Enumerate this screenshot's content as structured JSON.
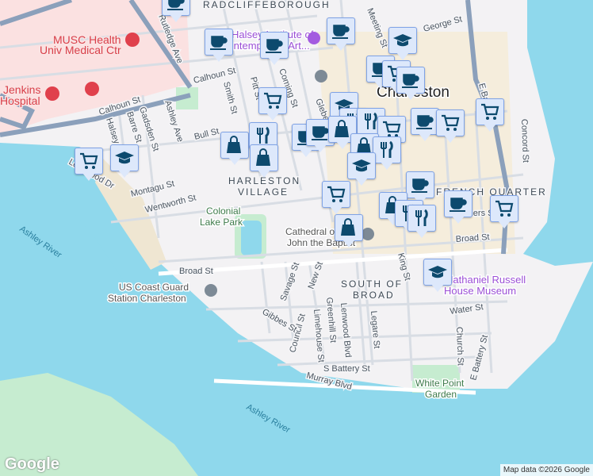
{
  "map": {
    "neighborhoods": [
      "RADCLIFFEBOROUGH",
      "HARLESTON",
      "VILLAGE",
      "FRENCH QUARTER",
      "SOUTH OF",
      "BROAD"
    ],
    "city": "Charleston",
    "streets": [
      "Rutledge Ave",
      "Calhoun St",
      "Calhoun St",
      "Smith St",
      "Pitt St",
      "Coming St",
      "Ashley Ave",
      "Halsey St",
      "Barre St",
      "Gadsden St",
      "Bull St",
      "Montagu St",
      "Lockwood Dr",
      "Wentworth St",
      "Broad St",
      "Broad St",
      "Meeting St",
      "George St",
      "Glebe St",
      "E Bay St",
      "Concord St",
      "Savage St",
      "New St",
      "King St",
      "Legare St",
      "Lenwood Blvd",
      "Greenhill St",
      "Limehouse St",
      "Council St",
      "Gibbes St",
      "Water St",
      "Church St",
      "E Battery St",
      "S Battery St",
      "Murray Blvd",
      "Chalmers St"
    ],
    "pois": {
      "musc": "MUSC Health\nUniv Medical Ctr",
      "musc_line1": "MUSC Health",
      "musc_line2": "Univ Medical Ctr",
      "jenkins_line1": "Jenkins",
      "jenkins_line2": "Hospital",
      "gibbes_line1": "Halsey Institute of",
      "gibbes_line2": "Contemporary Art...",
      "colonial_line1": "Colonial",
      "colonial_line2": "Lake Park",
      "coast_line1": "US Coast Guard",
      "coast_line2": "Station Charleston",
      "cathedral_line1": "Cathedral of St",
      "cathedral_line2": "John the Baptist",
      "russell_line1": "Nathaniel Russell",
      "russell_line2": "House Museum",
      "whitepoint_line1": "White Point",
      "whitepoint_line2": "Garden"
    },
    "water": [
      "Ashley River",
      "Ashley River"
    ],
    "markers": [
      "coffee",
      "coffee",
      "coffee",
      "coffee",
      "graduation",
      "coffee",
      "cart",
      "coffee",
      "cart",
      "graduation",
      "fork",
      "fork",
      "cart",
      "coffee",
      "cart",
      "cart",
      "bag",
      "fork",
      "bag",
      "coffee",
      "coffee",
      "bag",
      "bag",
      "fork",
      "graduation",
      "cart",
      "graduation",
      "coffee",
      "cart",
      "bag",
      "fork",
      "fork",
      "bag",
      "coffee",
      "cart",
      "graduation"
    ]
  },
  "footer": {
    "logo": "Google",
    "attribution": "Map data ©2026 Google"
  },
  "colors": {
    "water": "#8fd8ec",
    "park": "#c6ecd0",
    "medical": "#fbe1e1",
    "marker_bg": "#dde8fb",
    "marker_icon": "#0d4a6e"
  }
}
